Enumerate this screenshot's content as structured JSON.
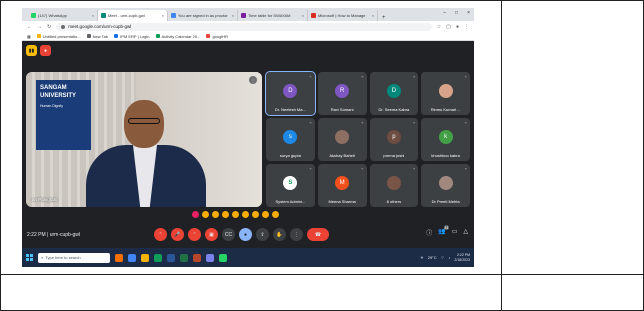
{
  "browser": {
    "tabs": [
      {
        "label": "(147) WhatsApp",
        "color": "#25d366",
        "active": false
      },
      {
        "label": "Meet - urm-cupb-gwl",
        "color": "#00897b",
        "active": true
      },
      {
        "label": "You are signed in as proctor",
        "color": "#4285f4",
        "active": false
      },
      {
        "label": "Time table for SWAYAM",
        "color": "#7b1fa2",
        "active": false
      },
      {
        "label": "Microsoft | How to Manage",
        "color": "#d93025",
        "active": false
      }
    ],
    "url": "meet.google.com/urm-cupb-gwl",
    "bookmarks": [
      {
        "label": "Untitled presentatio...",
        "color": "#f4b400"
      },
      {
        "label": "New Tab",
        "color": "#5f6368"
      },
      {
        "label": "IPM ERP | Login",
        "color": "#1a73e8"
      },
      {
        "label": "Activity Calendar 20...",
        "color": "#0f9d58"
      },
      {
        "label": "googlHR",
        "color": "#ea4335"
      }
    ]
  },
  "meet": {
    "speaker": {
      "name": "an Panigrahi",
      "banner_title": "SANGAM UNIVERSITY",
      "banner_sub": "Human Dignity"
    },
    "participants": [
      {
        "name": "Dr. Neelesh Ma...",
        "initial": "D",
        "color": "#7e57c2",
        "highlight": true
      },
      {
        "name": "Ravi Somani",
        "initial": "R",
        "color": "#7e57c2"
      },
      {
        "name": "Dr. Seema Kabra",
        "initial": "D",
        "color": "#00897b"
      },
      {
        "name": "Rinmo Kumari ...",
        "initial": "",
        "color": "#d7a38b"
      },
      {
        "name": "surya gupta",
        "initial": "s",
        "color": "#1e88e5"
      },
      {
        "name": "Akshay Baheti",
        "initial": "",
        "color": "#8d6e63"
      },
      {
        "name": "prerna joshi",
        "initial": "p",
        "color": "#6d4c41"
      },
      {
        "name": "khushboo kabra",
        "initial": "k",
        "color": "#43a047"
      },
      {
        "name": "System Admini...",
        "initial": "S",
        "color": "#ffffff"
      },
      {
        "name": "Meena Sharma",
        "initial": "M",
        "color": "#f4511e"
      },
      {
        "name": "8 others",
        "initial": "",
        "color": "#795548"
      },
      {
        "name": "Dr Preeti Mehta",
        "initial": "",
        "color": "#a1887f"
      }
    ],
    "time": "2:22 PM",
    "divider": "|",
    "meeting_code": "urm-cupb-gwl",
    "participant_count": "23"
  },
  "taskbar": {
    "search_placeholder": "Type here to search",
    "weather": "29°C",
    "time": "2:22 PM",
    "date": "2/18/2023"
  }
}
